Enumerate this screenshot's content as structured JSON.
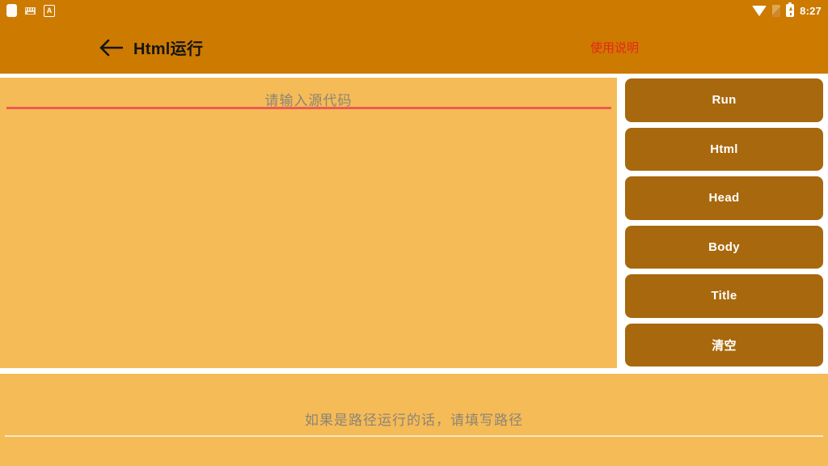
{
  "statusbar": {
    "icons_left": [
      "notification-icon",
      "keyboard-icon",
      "ime-indicator-icon"
    ],
    "icons_right": [
      "wifi-icon",
      "sim-card-icon",
      "battery-charging-icon"
    ],
    "ime_letter": "A",
    "time": "8:27"
  },
  "actionbar": {
    "back_icon": "back-arrow-icon",
    "title": "Html运行",
    "action_label": "使用说明",
    "action_color": "#E8261B",
    "background": "#CC7A00"
  },
  "editor": {
    "placeholder": "请输入源代码",
    "value": "",
    "underline_color": "#EE5A55",
    "background": "#F5BB56"
  },
  "buttons": [
    {
      "id": "run",
      "label": "Run"
    },
    {
      "id": "html",
      "label": "Html"
    },
    {
      "id": "head",
      "label": "Head"
    },
    {
      "id": "body",
      "label": "Body"
    },
    {
      "id": "title",
      "label": "Title"
    },
    {
      "id": "clear",
      "label": "清空"
    }
  ],
  "button_style": {
    "background": "#A8680D",
    "text_color": "#FFFFFF"
  },
  "path_field": {
    "placeholder": "如果是路径运行的话，请填写路径",
    "value": "",
    "underline_color": "#FBE7BE"
  }
}
